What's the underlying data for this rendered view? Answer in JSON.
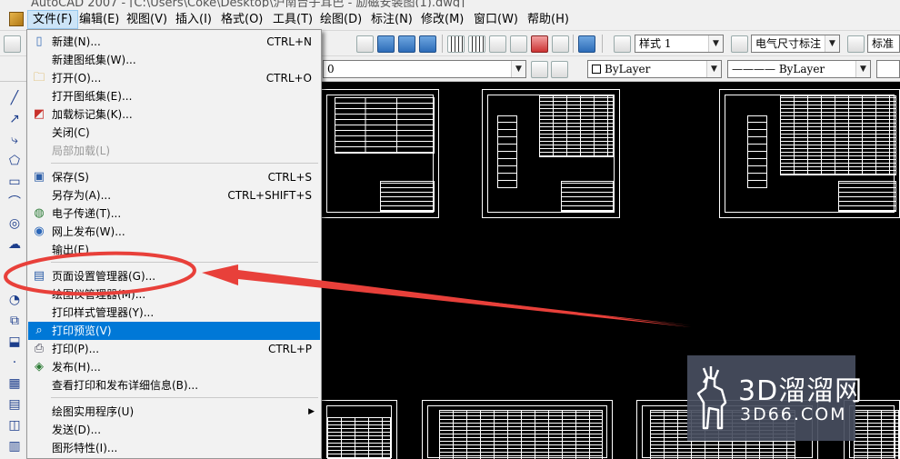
{
  "window": {
    "title_partial": "AutoCAD 2007 - [C:\\Users\\Coke\\Desktop\\沪南台子耳巴 - 励磁安装图(1).dwg]"
  },
  "menubar": {
    "items": [
      {
        "label": "文件(F)",
        "active": true
      },
      {
        "label": "编辑(E)"
      },
      {
        "label": "视图(V)"
      },
      {
        "label": "插入(I)"
      },
      {
        "label": "格式(O)"
      },
      {
        "label": "工具(T)"
      },
      {
        "label": "绘图(D)"
      },
      {
        "label": "标注(N)"
      },
      {
        "label": "修改(M)"
      },
      {
        "label": "窗口(W)"
      },
      {
        "label": "帮助(H)"
      }
    ]
  },
  "toolbar1": {
    "text_style": "样式 1",
    "dim_style": "电气尺寸标注",
    "table_style": "标准"
  },
  "toolbar2": {
    "layer": "0",
    "color": "ByLayer",
    "linetype": "———— ByLayer"
  },
  "file_menu": {
    "items": [
      {
        "label": "新建(N)...",
        "shortcut": "CTRL+N",
        "icon": "new-file-icon"
      },
      {
        "label": "新建图纸集(W)...",
        "shortcut": ""
      },
      {
        "label": "打开(O)...",
        "shortcut": "CTRL+O",
        "icon": "open-folder-icon"
      },
      {
        "label": "打开图纸集(E)...",
        "shortcut": ""
      },
      {
        "label": "加载标记集(K)...",
        "shortcut": "",
        "icon": "markup-icon"
      },
      {
        "label": "关闭(C)",
        "shortcut": ""
      },
      {
        "label": "局部加载(L)",
        "shortcut": "",
        "disabled": true
      },
      {
        "label": "保存(S)",
        "shortcut": "CTRL+S",
        "icon": "save-icon"
      },
      {
        "label": "另存为(A)...",
        "shortcut": "CTRL+SHIFT+S"
      },
      {
        "label": "电子传递(T)...",
        "shortcut": "",
        "icon": "etransmit-icon"
      },
      {
        "label": "网上发布(W)...",
        "shortcut": "",
        "icon": "publish-web-icon"
      },
      {
        "label": "输出(E)...",
        "shortcut": ""
      },
      {
        "label": "页面设置管理器(G)...",
        "shortcut": "",
        "icon": "page-setup-icon"
      },
      {
        "label": "绘图仪管理器(M)...",
        "shortcut": ""
      },
      {
        "label": "打印样式管理器(Y)...",
        "shortcut": ""
      },
      {
        "label": "打印预览(V)",
        "shortcut": "",
        "icon": "plot-preview-icon",
        "selected": true
      },
      {
        "label": "打印(P)...",
        "shortcut": "CTRL+P",
        "icon": "print-icon"
      },
      {
        "label": "发布(H)...",
        "shortcut": "",
        "icon": "publish-icon"
      },
      {
        "label": "查看打印和发布详细信息(B)...",
        "shortcut": ""
      },
      {
        "label": "绘图实用程序(U)",
        "shortcut": "",
        "submenu": true
      },
      {
        "label": "发送(D)...",
        "shortcut": ""
      },
      {
        "label": "图形特性(I)...",
        "shortcut": ""
      }
    ]
  },
  "annotation": {
    "ellipse_color": "#e8403a",
    "arrow_color": "#e8403a"
  },
  "watermark": {
    "big": "3D溜溜网",
    "small": "3D66.COM"
  }
}
